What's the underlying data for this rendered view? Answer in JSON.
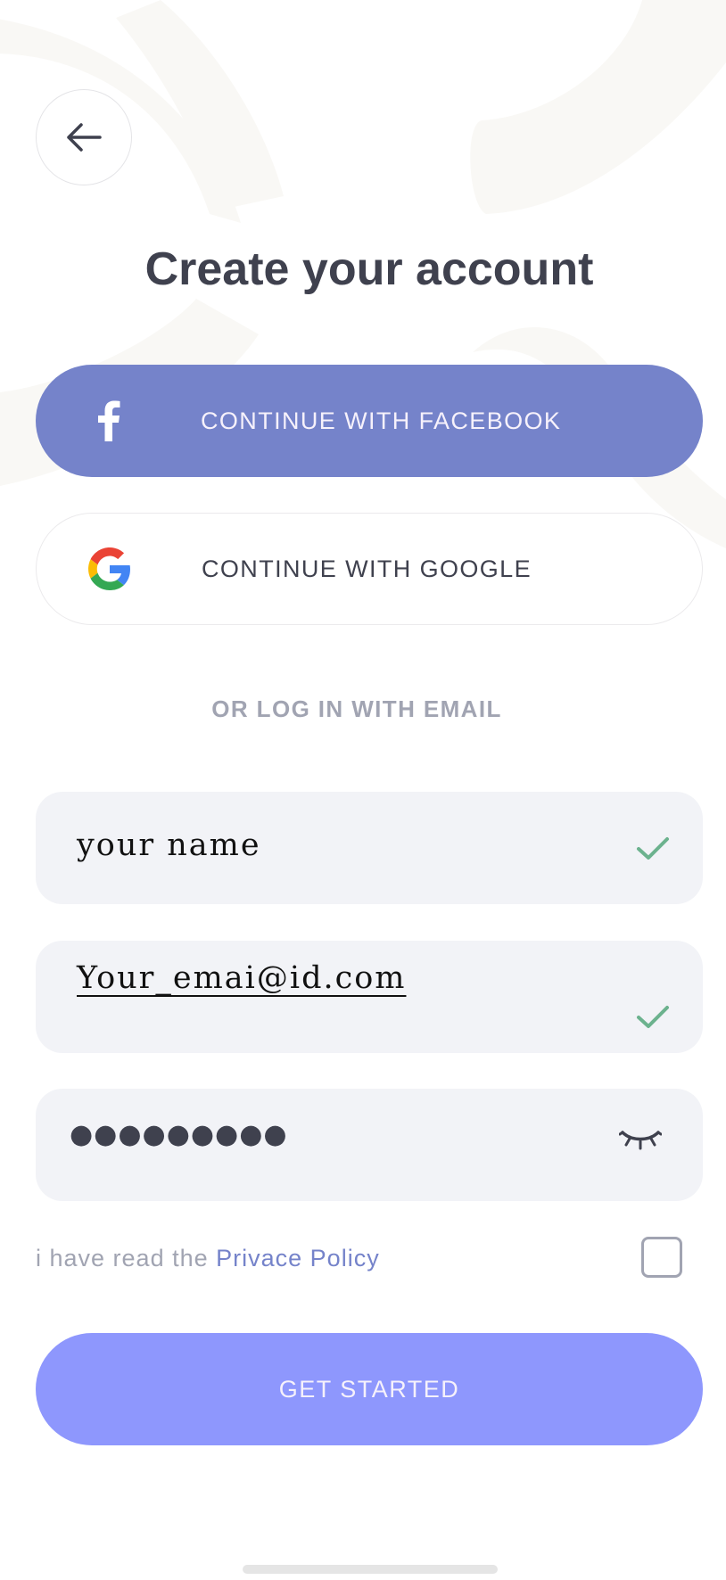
{
  "page": {
    "title": "Create your account"
  },
  "social": {
    "facebook_label": "CONTINUE WITH FACEBOOK",
    "facebook_icon": "facebook-f-icon",
    "google_label": "CONTINUE WITH GOOGLE",
    "google_icon": "google-g-icon"
  },
  "divider": {
    "text": "OR LOG IN WITH EMAIL"
  },
  "form": {
    "name_value": "your name",
    "email_value": "Your_emai@id.com",
    "password_value": "●●●●●●●●●",
    "name_status_icon": "check-icon",
    "email_status_icon": "check-icon",
    "password_toggle_icon": "eye-closed-icon"
  },
  "policy": {
    "prefix": "i have read the ",
    "link": "Privace Policy",
    "checked": false
  },
  "cta": {
    "label": "GET STARTED"
  },
  "colors": {
    "primary": "#8e97fd",
    "facebook": "#7583ca",
    "text_dark": "#3f414e",
    "text_muted": "#a1a4b2",
    "field_bg": "#f2f3f7",
    "check_green": "#6cb28e"
  }
}
